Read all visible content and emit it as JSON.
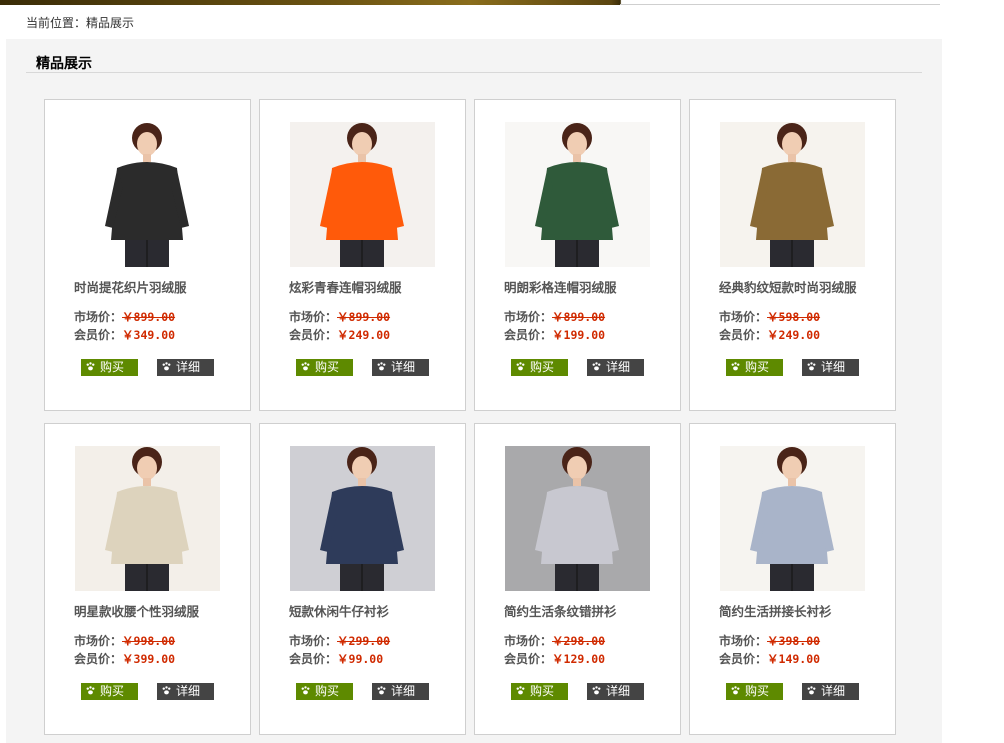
{
  "breadcrumb": {
    "prefix": "当前位置：",
    "current": "精品展示"
  },
  "section": {
    "title": "精品展示"
  },
  "labels": {
    "market": "市场价：",
    "member": "会员价：",
    "buy": "购买",
    "detail": "详细"
  },
  "products": [
    {
      "name": "时尚提花织片羽绒服",
      "market": "￥899.00",
      "member": "￥349.00",
      "image": "woman-black-down-jacket",
      "color": "#2b2b2b"
    },
    {
      "name": "炫彩青春连帽羽绒服",
      "market": "￥899.00",
      "member": "￥249.00",
      "image": "woman-orange-down-jacket",
      "color": "#ff5a0a"
    },
    {
      "name": "明朗彩格连帽羽绒服",
      "market": "￥899.00",
      "member": "￥199.00",
      "image": "woman-plaid-down-jacket",
      "color": "#2f5a3a"
    },
    {
      "name": "经典豹纹短款时尚羽绒服",
      "market": "￥598.00",
      "member": "￥249.00",
      "image": "woman-leopard-jacket",
      "color": "#8a6a35"
    },
    {
      "name": "明星款收腰个性羽绒服",
      "market": "￥998.00",
      "member": "￥399.00",
      "image": "woman-beige-coat",
      "color": "#ddd3bd"
    },
    {
      "name": "短款休闲牛仔衬衫",
      "market": "￥299.00",
      "member": "￥99.00",
      "image": "woman-denim-shirt",
      "color": "#2e3b5a"
    },
    {
      "name": "简约生活条纹错拼衫",
      "market": "￥298.00",
      "member": "￥129.00",
      "image": "woman-striped-shirt",
      "color": "#c8c8d0"
    },
    {
      "name": "简约生活拼接长衬衫",
      "market": "￥398.00",
      "member": "￥149.00",
      "image": "woman-blue-long-shirt",
      "color": "#a9b4c9"
    }
  ]
}
